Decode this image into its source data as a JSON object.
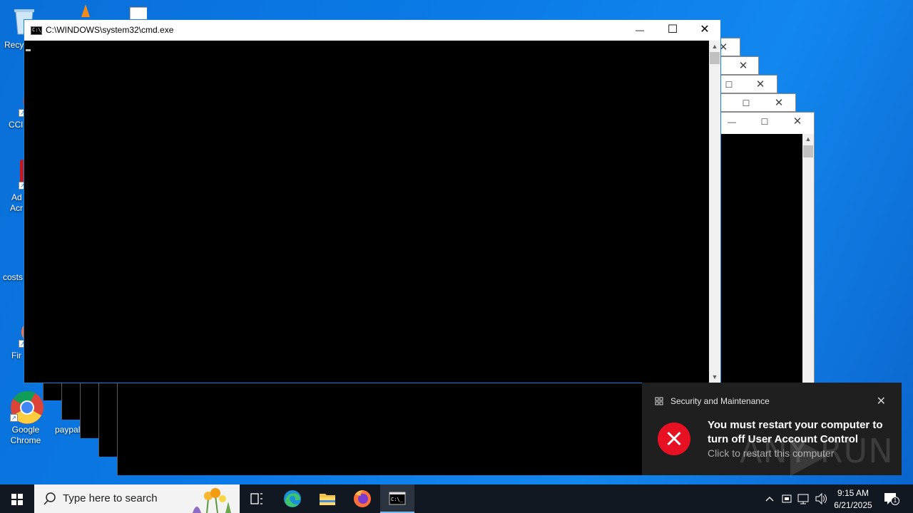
{
  "desktop": {
    "icons": [
      {
        "label": "Recy",
        "icon": "recycle-bin-icon"
      },
      {
        "label": "CCl",
        "icon": "ccleaner-icon"
      },
      {
        "label": "Ad",
        "label2": "Acr",
        "icon": "acrobat-reader-icon"
      },
      {
        "label": "costs",
        "icon": "document-icon"
      },
      {
        "label": "Fir",
        "icon": "firefox-icon"
      },
      {
        "label": "Google",
        "label2": "Chrome",
        "icon": "chrome-icon"
      },
      {
        "label": "paypal",
        "icon": "paypal-file-icon"
      }
    ]
  },
  "cmd_window": {
    "title": "C:\\WINDOWS\\system32\\cmd.exe",
    "icon": "cmd-icon",
    "minimize": "—",
    "maximize": "☐",
    "close": "✕"
  },
  "background_windows": {
    "count": 5,
    "close_glyph": "✕",
    "maximize_glyph": "☐",
    "minimize_glyph": "—"
  },
  "toast": {
    "app": "Security and Maintenance",
    "message": "You must restart your computer to turn off User Account Control",
    "action": "Click to restart this computer",
    "close": "✕",
    "error_color": "#e81123"
  },
  "watermark": {
    "text": "ANY RUN"
  },
  "taskbar": {
    "search_placeholder": "Type here to search",
    "pinned": [
      "task-view-icon",
      "edge-icon",
      "file-explorer-icon",
      "firefox-icon",
      "cmd-icon"
    ],
    "tray_icons": [
      "chevron-up-icon",
      "usb-icon",
      "network-icon",
      "volume-icon"
    ],
    "time": "9:15 AM",
    "date": "6/21/2025",
    "notification_count": "1"
  }
}
